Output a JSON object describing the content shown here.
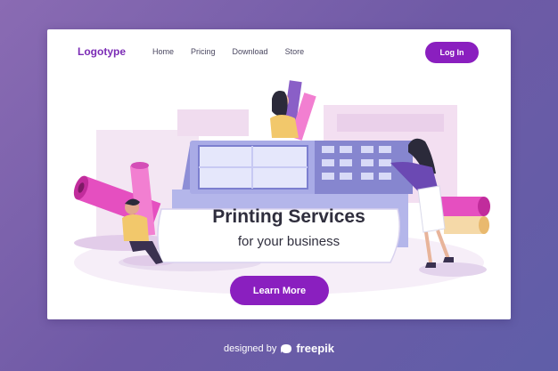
{
  "header": {
    "logo": "Logotype",
    "nav": [
      "Home",
      "Pricing",
      "Download",
      "Store"
    ],
    "login_label": "Log In"
  },
  "hero": {
    "title": "Printing Services",
    "subtitle": "for your business",
    "cta_label": "Learn More"
  },
  "footer": {
    "credit_prefix": "designed by",
    "credit_brand": "freepik"
  },
  "colors": {
    "accent": "#8a1fbf",
    "background_gradient": [
      "#8a6bb3",
      "#5f5ea8"
    ],
    "text_dark": "#2f2e3d"
  }
}
